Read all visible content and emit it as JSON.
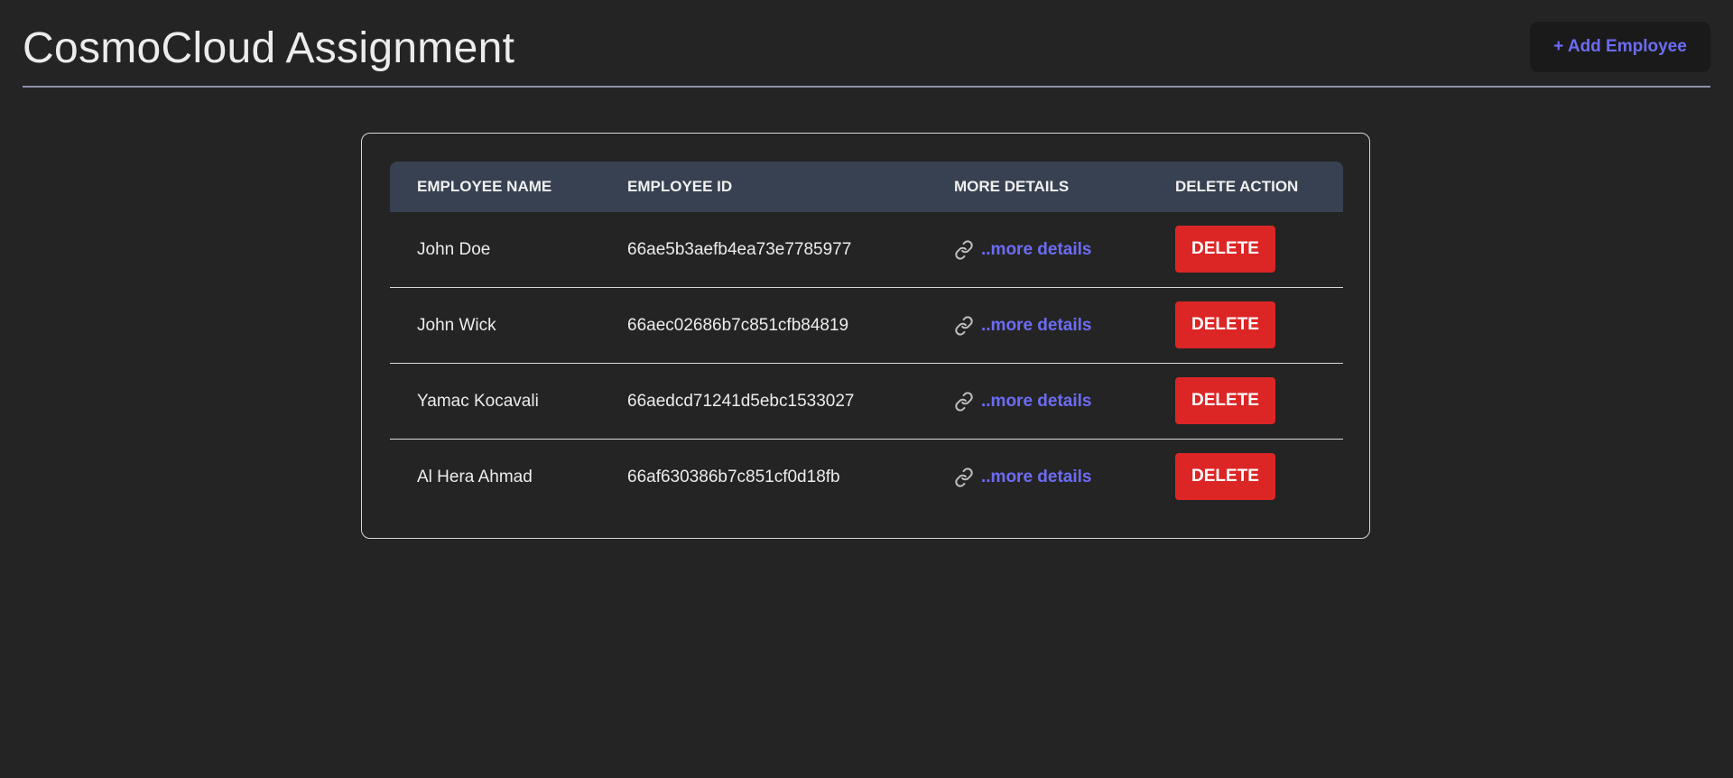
{
  "header": {
    "title": "CosmoCloud Assignment",
    "add_button_label": "+ Add Employee"
  },
  "table": {
    "columns": [
      "EMPLOYEE NAME",
      "EMPLOYEE ID",
      "MORE DETAILS",
      "DELETE ACTION"
    ],
    "rows": [
      {
        "name": "John Doe",
        "id": "66ae5b3aefb4ea73e7785977",
        "details_label": "..more details",
        "delete_label": "DELETE"
      },
      {
        "name": "John Wick",
        "id": "66aec02686b7c851cfb84819",
        "details_label": "..more details",
        "delete_label": "DELETE"
      },
      {
        "name": "Yamac Kocavali",
        "id": "66aedcd71241d5ebc1533027",
        "details_label": "..more details",
        "delete_label": "DELETE"
      },
      {
        "name": "Al Hera Ahmad",
        "id": "66af630386b7c851cf0d18fb",
        "details_label": "..more details",
        "delete_label": "DELETE"
      }
    ]
  },
  "colors": {
    "background": "#242424",
    "accent_link": "#6c6cf5",
    "delete": "#dc2626",
    "table_header": "#374151"
  },
  "icons": {
    "details": "link-icon"
  }
}
